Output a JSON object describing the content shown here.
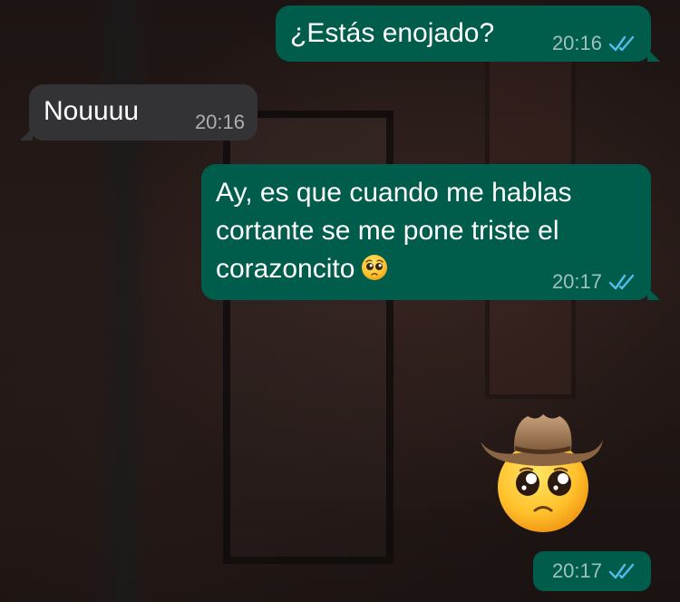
{
  "theme": {
    "outgoing_bubble": "#005c4b",
    "incoming_bubble": "#333336",
    "read_tick_color": "#53bdeb"
  },
  "messages": [
    {
      "direction": "out",
      "text": "¿Estás enojado?",
      "time": "20:16",
      "status": "read"
    },
    {
      "direction": "in",
      "text": "Nouuuu",
      "time": "20:16"
    },
    {
      "direction": "out",
      "text": "Ay, es que cuando me hablas cortante se me pone triste el corazoncito",
      "emoji": "pleading-face",
      "time": "20:17",
      "status": "read"
    },
    {
      "direction": "out",
      "type": "sticker",
      "sticker": "cowboy-pleading-face",
      "time": "20:17",
      "status": "read"
    }
  ]
}
